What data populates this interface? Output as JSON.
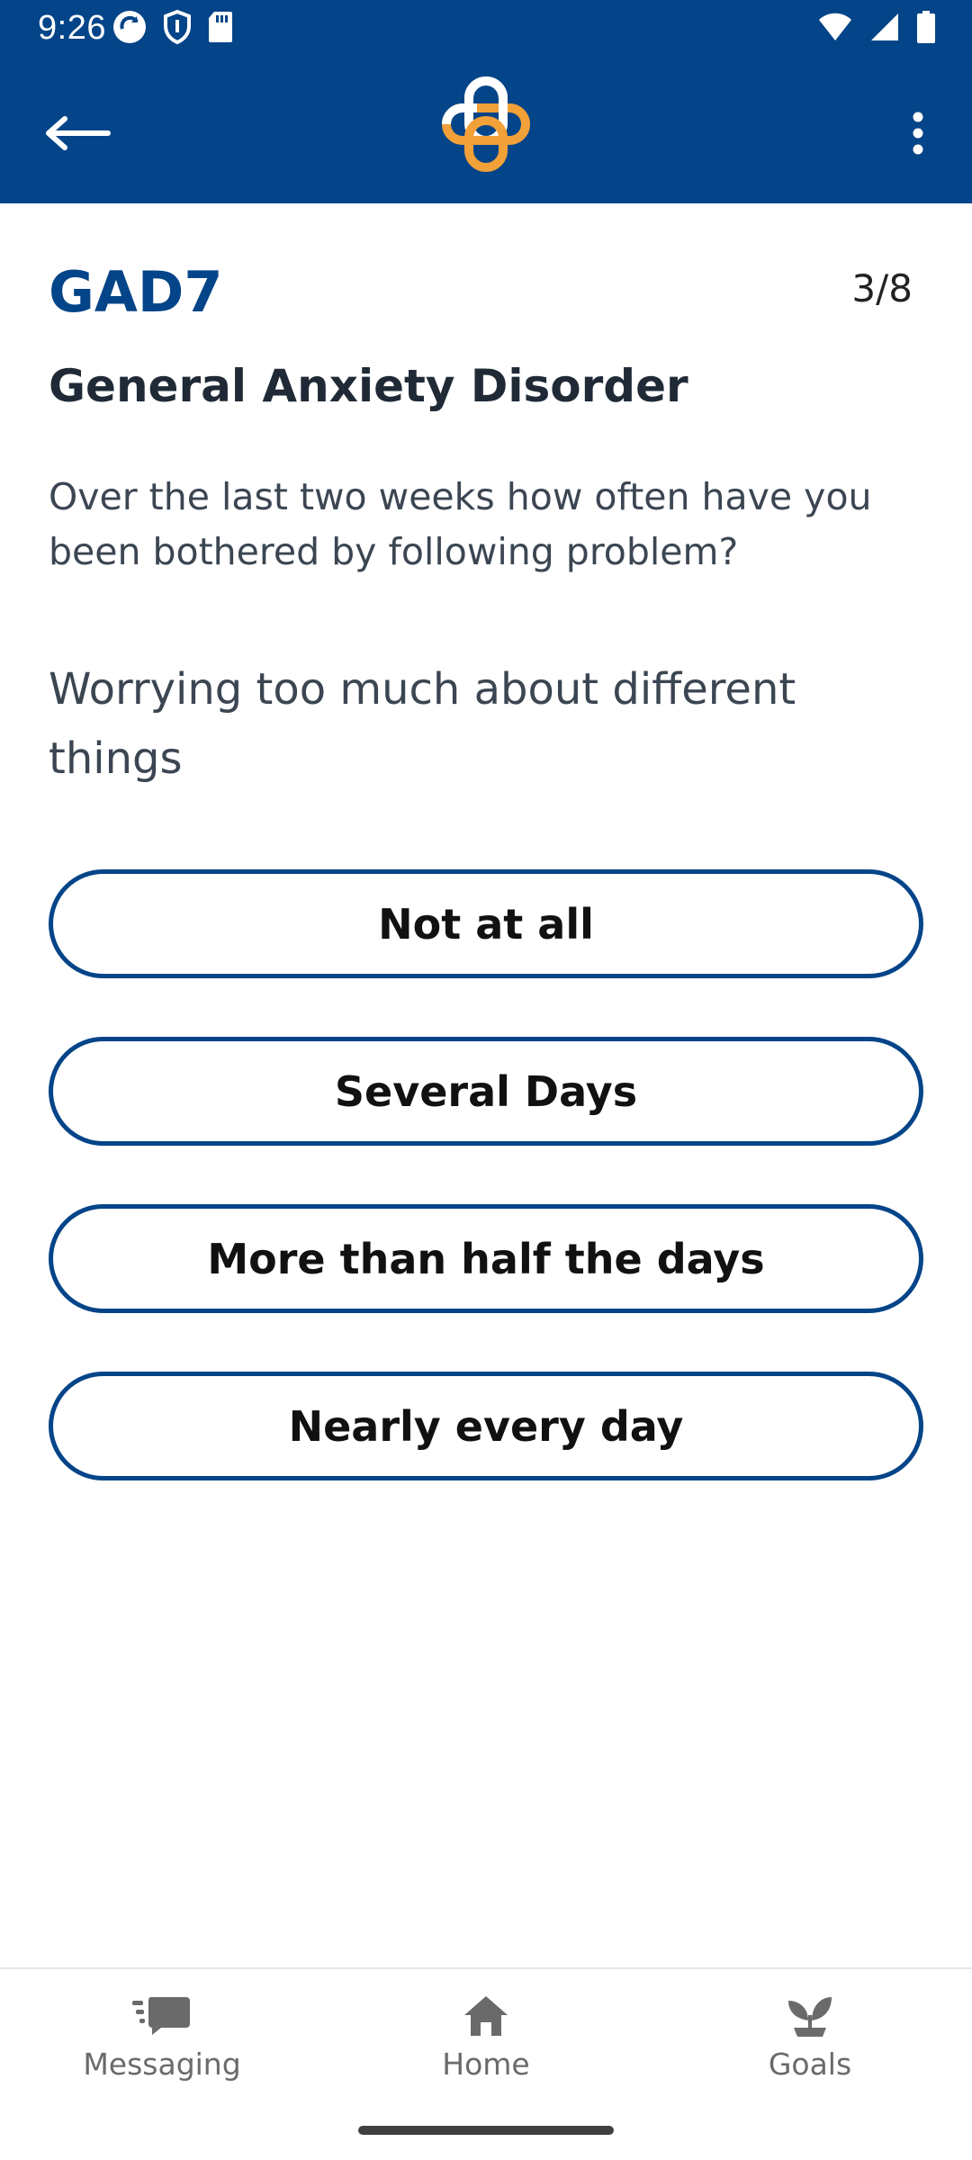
{
  "status_bar": {
    "time": "9:26",
    "left_icons": [
      "sync-icon",
      "shield-icon",
      "sd-card-icon"
    ],
    "right_icons": [
      "wifi-icon",
      "signal-icon",
      "battery-icon"
    ]
  },
  "app_bar": {
    "back_icon": "arrow-left-icon",
    "logo": "app-logo",
    "menu_icon": "more-vert-icon",
    "colors": {
      "background": "#044488",
      "logo_white": "#ffffff",
      "logo_orange": "#F2A038"
    }
  },
  "survey": {
    "code": "GAD7",
    "progress": "3/8",
    "title": "General Anxiety Disorder",
    "instructions": "Over the last two weeks how often have you been bothered by following problem?",
    "question": "Worrying too much about different things",
    "options": [
      {
        "label": "Not at all"
      },
      {
        "label": "Several Days"
      },
      {
        "label": "More than half the days"
      },
      {
        "label": "Nearly every day"
      }
    ]
  },
  "bottom_nav": {
    "items": [
      {
        "label": "Messaging",
        "icon": "chat-icon"
      },
      {
        "label": "Home",
        "icon": "home-icon"
      },
      {
        "label": "Goals",
        "icon": "sprout-icon"
      }
    ]
  },
  "theme": {
    "primary": "#044488",
    "accent": "#F2A038",
    "nav_icon": "#6a6a6a"
  }
}
